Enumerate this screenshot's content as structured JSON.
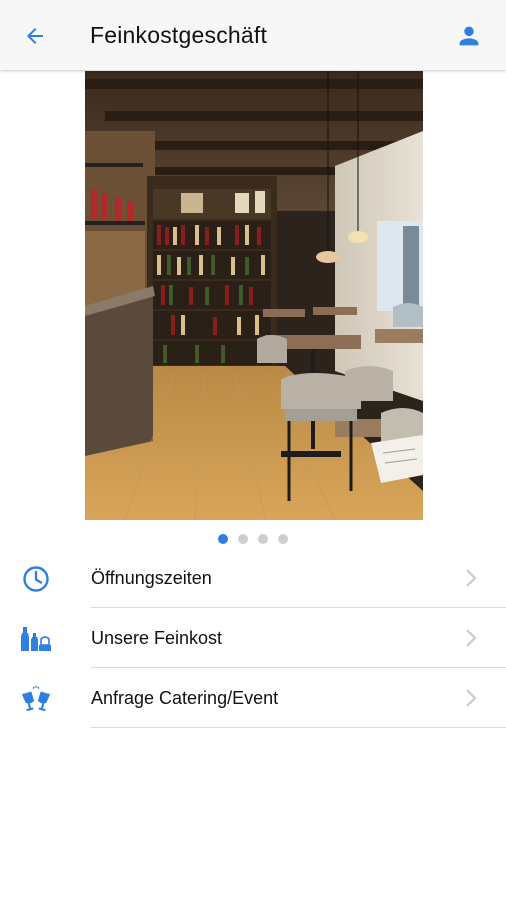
{
  "header": {
    "title": "Feinkostgeschäft",
    "back_icon": "arrow-left-icon",
    "profile_icon": "person-icon",
    "accent_color": "#2f7fe0"
  },
  "gallery": {
    "image_description_icon": "deli-interior-photo",
    "page_count": 4,
    "active_index": 0
  },
  "menu": {
    "items": [
      {
        "label": "Öffnungszeiten",
        "icon": "clock-icon"
      },
      {
        "label": "Unsere Feinkost",
        "icon": "wine-bottles-icon"
      },
      {
        "label": "Anfrage Catering/Event",
        "icon": "toast-glasses-icon"
      }
    ],
    "chevron_icon": "chevron-right-icon"
  }
}
